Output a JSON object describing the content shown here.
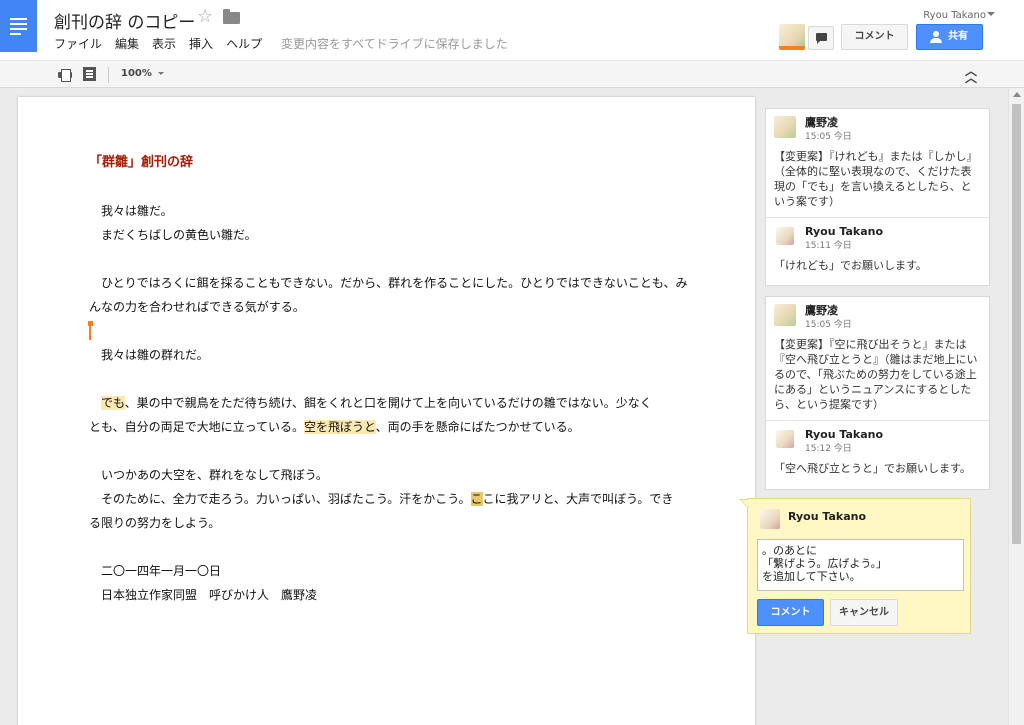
{
  "header": {
    "title": "創刊の辞 のコピー",
    "menu": [
      "ファイル",
      "編集",
      "表示",
      "挿入",
      "ヘルプ"
    ],
    "save_status": "変更内容をすべてドライブに保存しました",
    "user_name": "Ryou Takano",
    "comment_button": "コメント",
    "share_button": "共有"
  },
  "toolbar": {
    "zoom": "100%"
  },
  "document": {
    "heading": "「群雛」創刊の辞",
    "p1_line1": "我々は雛だ。",
    "p1_line2": "まだくちばしの黄色い雛だ。",
    "p2_line1": "ひとりではろくに餌を採ることもできない。だから、群れを作ることにした。ひとりではできないことも、み",
    "p2_line2": "んなの力を合わせればできる気がする。",
    "p3": "我々は雛の群れだ。",
    "p4_hl1": "でも",
    "p4_line1_rest": "、巣の中で親鳥をただ待ち続け、餌をくれと口を開けて上を向いているだけの雛ではない。少なく",
    "p4_line2_pre": "とも、自分の両足で大地に立っている。",
    "p4_hl2": "空を飛ぼうと",
    "p4_line2_post": "、両の手を懸命にばたつかせている。",
    "p5_line1": "いつかあの大空を、群れをなして飛ぼう。",
    "p5_line2_pre": "そのために、全力で走ろう。力いっぱい、羽ばたこう。汗をかこう。",
    "p5_hl": "こ",
    "p5_line2_post": "こに我アリと、大声で叫ぼう。でき",
    "p5_line3": "る限りの努力をしよう。",
    "date": "二〇一四年一月一〇日",
    "signature": "日本独立作家同盟　呼びかけ人　鷹野凌"
  },
  "comments": [
    {
      "author": "鷹野凌",
      "time": "15:05 今日",
      "body": "【変更案】『けれども』または『しかし』（全体的に堅い表現なので、くだけた表現の「でも」を言い換えるとしたら、という案です）",
      "reply_author": "Ryou Takano",
      "reply_time": "15:11 今日",
      "reply_body": "「けれども」でお願いします。"
    },
    {
      "author": "鷹野凌",
      "time": "15:05 今日",
      "body": "【変更案】『空に飛び出そうと』または『空へ飛び立とうと』（雛はまだ地上にいるので、「飛ぶための努力をしている途上にある」というニュアンスにするとしたら、という提案です）",
      "reply_author": "Ryou Takano",
      "reply_time": "15:12 今日",
      "reply_body": "「空へ飛び立とうと」でお願いします。"
    }
  ],
  "new_comment": {
    "author": "Ryou Takano",
    "text": "。のあとに\n「繋げよう。広げよう。」\nを追加して下さい。",
    "comment_button": "コメント",
    "cancel_button": "キャンセル"
  }
}
